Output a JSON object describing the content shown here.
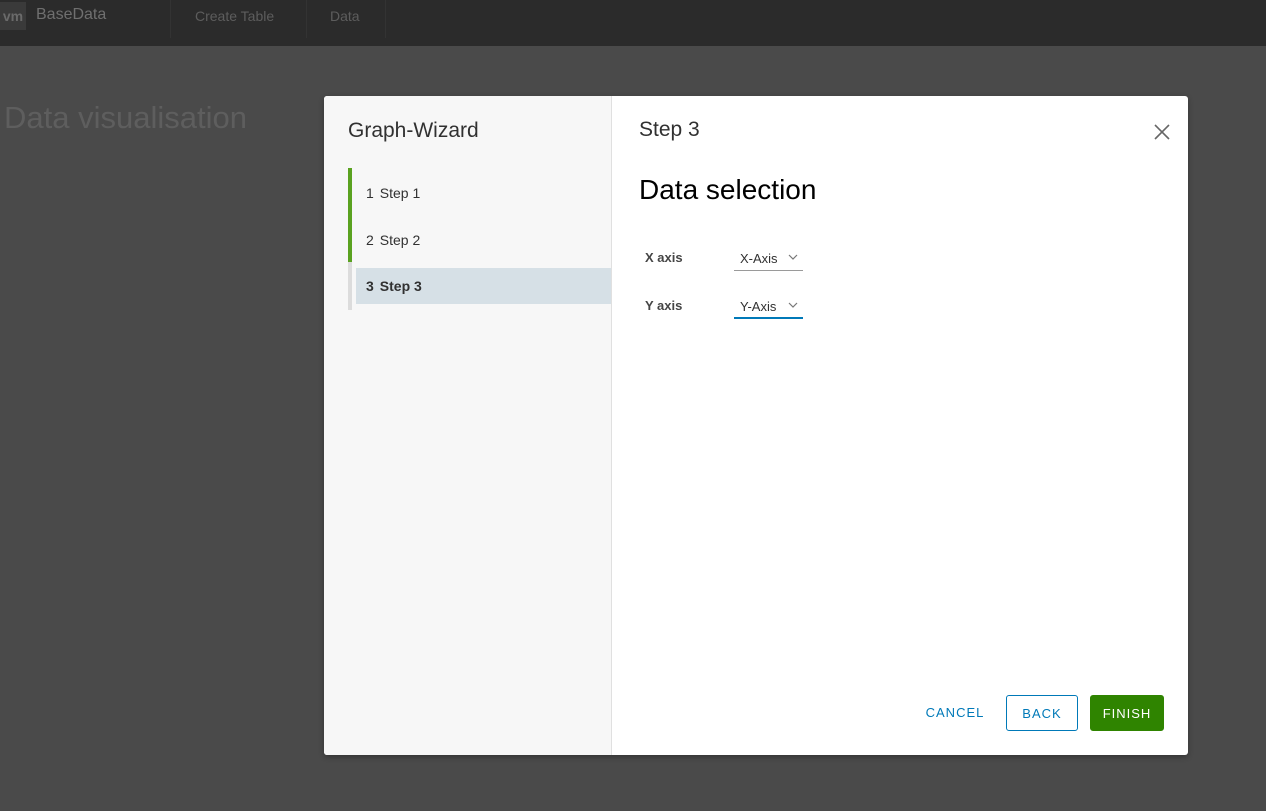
{
  "app": {
    "logo": "vm",
    "title": "BaseData",
    "nav": [
      {
        "label": "Create Table"
      },
      {
        "label": "Data"
      }
    ]
  },
  "page": {
    "title": "Data visualisation"
  },
  "wizard": {
    "title": "Graph-Wizard",
    "steps": [
      {
        "number": "1",
        "label": "Step 1",
        "state": "completed"
      },
      {
        "number": "2",
        "label": "Step 2",
        "state": "completed"
      },
      {
        "number": "3",
        "label": "Step 3",
        "state": "current"
      }
    ],
    "current_step_header": "Step 3",
    "section_title": "Data selection",
    "fields": [
      {
        "label": "X axis",
        "selected": "X-Axis"
      },
      {
        "label": "Y axis",
        "selected": "Y-Axis"
      }
    ],
    "buttons": {
      "cancel": "CANCEL",
      "back": "BACK",
      "finish": "FINISH"
    }
  },
  "colors": {
    "accent": "#0079b8",
    "completed_step": "#5aa220",
    "finish_button": "#2f8400",
    "active_step_bg": "#d6e0e6"
  }
}
